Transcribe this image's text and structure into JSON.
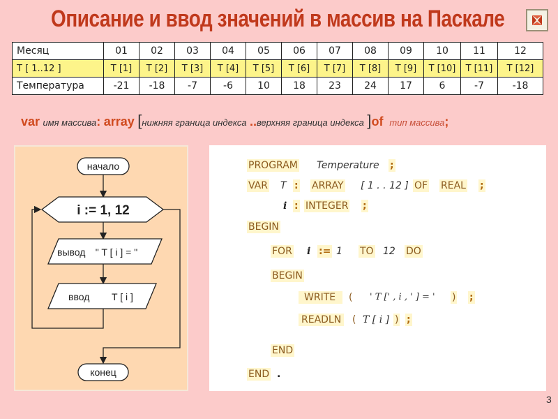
{
  "title": "Описание и ввод значений в массив на Паскале",
  "close_icon": "close-x-icon",
  "table": {
    "rows": [
      {
        "label": "Месяц",
        "cells": [
          "01",
          "02",
          "03",
          "04",
          "05",
          "06",
          "07",
          "08",
          "09",
          "10",
          "11",
          "12"
        ]
      },
      {
        "label": "T [ 1..12 ]",
        "cells": [
          "T [1]",
          "T [2]",
          "T [3]",
          "T [4]",
          "T [5]",
          "T [6]",
          "T [7]",
          "T [8]",
          "T [9]",
          "T [10]",
          "T [11]",
          "T [12]"
        ]
      },
      {
        "label": "Температура",
        "cells": [
          "-21",
          "-18",
          "-7",
          "-6",
          "10",
          "18",
          "23",
          "24",
          "17",
          "6",
          "-7",
          "-18"
        ]
      }
    ]
  },
  "syntax": {
    "var": "var",
    "name": "имя массива",
    "colon": ":",
    "array": "array",
    "lbracket": "[",
    "lower": "нижняя граница индекса",
    "dots": "..",
    "upper": "верхняя граница индекса",
    "rbracket": "]",
    "of": "of",
    "type": "тип массива",
    "semicolon": ";"
  },
  "flowchart": {
    "start": "начало",
    "loop": "i := 1, 12",
    "output_label": "вывод",
    "output_value": "\" T [ i ] = \"",
    "input_label": "ввод",
    "input_value": "T [ i ]",
    "end": "конец"
  },
  "code": {
    "l1": [
      "PROGRAM",
      "Temperature",
      ";"
    ],
    "l2": [
      "VAR",
      "T",
      ":",
      "ARRAY",
      "[ 1 . . 12 ]",
      "OF",
      "REAL",
      ";"
    ],
    "l3": [
      "i",
      ":",
      "INTEGER",
      ";"
    ],
    "l4": [
      "BEGIN"
    ],
    "l5": [
      "FOR",
      "i",
      ":=",
      "1",
      "TO",
      "12",
      "DO"
    ],
    "l6": [
      "BEGIN"
    ],
    "l7": [
      "WRITE",
      "(",
      "' T [' , i , ' ] = '",
      ")",
      ";"
    ],
    "l8": [
      "READLN",
      "(",
      "T [ i ]",
      ")",
      ";"
    ],
    "l9": [
      "END"
    ],
    "l10": [
      "END",
      "."
    ]
  },
  "page_number": "3"
}
